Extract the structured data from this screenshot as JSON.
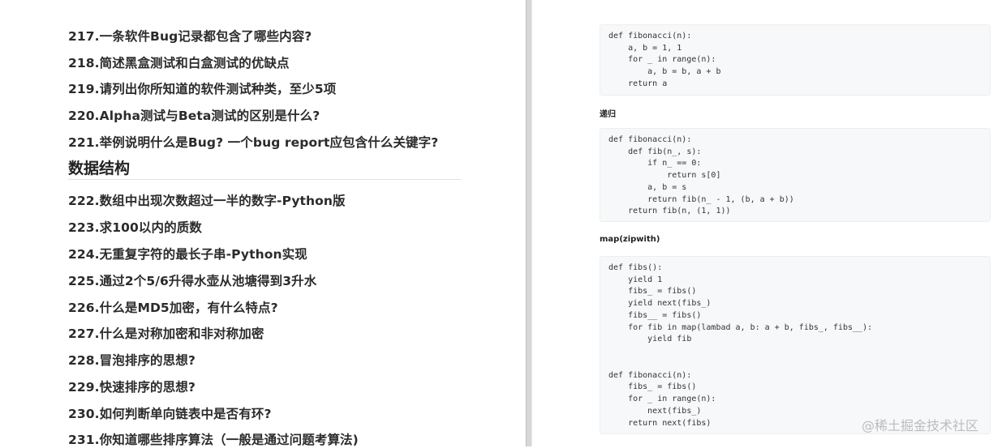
{
  "questions_top": [
    "217.一条软件Bug记录都包含了哪些内容?",
    "218.简述黑盒测试和白盒测试的优缺点",
    "219.请列出你所知道的软件测试种类，至少5项",
    "220.Alpha测试与Beta测试的区别是什么?",
    "221.举例说明什么是Bug? 一个bug report应包含什么关键字?"
  ],
  "section_title": "数据结构",
  "questions_bottom": [
    "222.数组中出现次数超过一半的数字-Python版",
    "223.求100以内的质数",
    "224.无重复字符的最长子串-Python实现",
    "225.通过2个5/6升得水壶从池塘得到3升水",
    "226.什么是MD5加密，有什么特点?",
    "227.什么是对称加密和非对称加密",
    "228.冒泡排序的思想?",
    "229.快速排序的思想?",
    "230.如何判断单向链表中是否有环?",
    "231.你知道哪些排序算法（一般是通过问题考算法)"
  ],
  "labels": {
    "recursion": "递归",
    "map_zipwith": "map(zipwith)"
  },
  "code_blocks": {
    "iterative": [
      "def fibonacci(n):",
      "    a, b = 1, 1",
      "    for _ in range(n):",
      "        a, b = b, a + b",
      "    return a"
    ],
    "recursive": [
      "def fibonacci(n):",
      "    def fib(n_, s):",
      "        if n_ == 0:",
      "            return s[0]",
      "        a, b = s",
      "        return fib(n_ - 1, (b, a + b))",
      "    return fib(n, (1, 1))"
    ],
    "map_zipwith": [
      "def fibs():",
      "    yield 1",
      "    fibs_ = fibs()",
      "    yield next(fibs_)",
      "    fibs__ = fibs()",
      "    for fib in map(lambad a, b: a + b, fibs_, fibs__):",
      "        yield fib",
      "",
      "",
      "def fibonacci(n):",
      "    fibs_ = fibs()",
      "    for _ in range(n):",
      "        next(fibs_)",
      "    return next(fibs)"
    ]
  },
  "watermark": "@稀土掘金技术社区"
}
